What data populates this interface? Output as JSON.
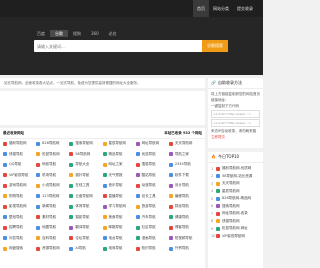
{
  "nav": {
    "items": [
      {
        "label": "首页",
        "active": true
      },
      {
        "label": "网站分类",
        "active": false
      },
      {
        "label": "提交收录",
        "active": false
      }
    ]
  },
  "search": {
    "tabs": [
      "百度",
      "谷歌",
      "搜狗",
      "360",
      "必应"
    ],
    "active_tab": "谷歌",
    "placeholder": "请输入关键词...",
    "button_label": "谷歌搜索"
  },
  "notice": "站长导航网，全面收录各大站点，一站式导航，免费为您提供高效便捷的网址大全服务。",
  "main": {
    "title": "最近收录网站",
    "right_text": "本站已收录 932 个网站",
    "sites": [
      {
        "name": "福利导航网",
        "color": "#e6473a"
      },
      {
        "name": "826导航网",
        "color": "#4a90e2"
      },
      {
        "name": "搜索导航网",
        "color": "#2aa876"
      },
      {
        "name": "星辰导航网",
        "color": "#f5a623"
      },
      {
        "name": "网址导航网",
        "color": "#9b59b6"
      },
      {
        "name": "天天导航网",
        "color": "#e6473a"
      },
      {
        "name": "快猫导航",
        "color": "#4a90e2"
      },
      {
        "name": "松鼠导航网",
        "color": "#f5a623"
      },
      {
        "name": "58导航网",
        "color": "#e6473a"
      },
      {
        "name": "精品导航",
        "color": "#2aa876"
      },
      {
        "name": "优选导航",
        "color": "#4a90e2"
      },
      {
        "name": "导航之家",
        "color": "#9b59b6"
      },
      {
        "name": "QQ导航",
        "color": "#4a90e2"
      },
      {
        "name": "蚂蚁导航",
        "color": "#e6473a"
      },
      {
        "name": "导航大全",
        "color": "#2aa876"
      },
      {
        "name": "网址之家",
        "color": "#f5a623"
      },
      {
        "name": "搜狐导航",
        "color": "#e6473a"
      },
      {
        "name": "2345导航",
        "color": "#4a90e2"
      },
      {
        "name": "VIP影视导航",
        "color": "#e6473a"
      },
      {
        "name": "机场导航",
        "color": "#4a90e2"
      },
      {
        "name": "猫扑导航",
        "color": "#f5a623"
      },
      {
        "name": "天气预报",
        "color": "#2aa876"
      },
      {
        "name": "酷站导航",
        "color": "#9b59b6"
      },
      {
        "name": "软件下载",
        "color": "#4a90e2"
      },
      {
        "name": "游戏导航网",
        "color": "#e6473a"
      },
      {
        "name": "小说导航网",
        "color": "#f5a623"
      },
      {
        "name": "在线工具",
        "color": "#2aa876"
      },
      {
        "name": "音乐导航",
        "color": "#4a90e2"
      },
      {
        "name": "动漫导航",
        "color": "#e6473a"
      },
      {
        "name": "设计导航",
        "color": "#9b59b6"
      },
      {
        "name": "购物导航",
        "color": "#f5a623"
      },
      {
        "name": "123导航网",
        "color": "#4a90e2"
      },
      {
        "name": "云盘导航网",
        "color": "#2aa876"
      },
      {
        "name": "直播导航",
        "color": "#e6473a"
      },
      {
        "name": "站长工具",
        "color": "#4a90e2"
      },
      {
        "name": "编程导航",
        "color": "#f5a623"
      },
      {
        "name": "影视导航网",
        "color": "#e6473a"
      },
      {
        "name": "新闻导航",
        "color": "#4a90e2"
      },
      {
        "name": "体育导航",
        "color": "#2aa876"
      },
      {
        "name": "学习导航网",
        "color": "#9b59b6"
      },
      {
        "name": "旅游导航",
        "color": "#f5a623"
      },
      {
        "name": "财经导航",
        "color": "#e6473a"
      },
      {
        "name": "壁纸导航",
        "color": "#4a90e2"
      },
      {
        "name": "素材导航",
        "color": "#e6473a"
      },
      {
        "name": "摄影导航",
        "color": "#2aa876"
      },
      {
        "name": "美食导航",
        "color": "#f5a623"
      },
      {
        "name": "汽车导航",
        "color": "#4a90e2"
      },
      {
        "name": "健康导航",
        "color": "#2aa876"
      },
      {
        "name": "招聘导航",
        "color": "#e6473a"
      },
      {
        "name": "地图导航",
        "color": "#4a90e2"
      },
      {
        "name": "翻译导航",
        "color": "#9b59b6"
      },
      {
        "name": "邮箱导航",
        "color": "#f5a623"
      },
      {
        "name": "社区导航",
        "color": "#2aa876"
      },
      {
        "name": "博客导航",
        "color": "#e6473a"
      },
      {
        "name": "问答导航",
        "color": "#4a90e2"
      },
      {
        "name": "百科导航",
        "color": "#f5a623"
      },
      {
        "name": "论坛导航",
        "color": "#e6473a"
      },
      {
        "name": "电台导航",
        "color": "#4a90e2"
      },
      {
        "name": "漫画导航",
        "color": "#2aa876"
      },
      {
        "name": "短视频导航",
        "color": "#9b59b6"
      },
      {
        "name": "网盘搜索",
        "color": "#f5a623"
      },
      {
        "name": "资源导航网",
        "color": "#e6473a"
      },
      {
        "name": "AI导航",
        "color": "#4a90e2"
      },
      {
        "name": "电商导航",
        "color": "#2aa876"
      },
      {
        "name": "知识导航",
        "color": "#e6473a"
      },
      {
        "name": "外贸导航",
        "color": "#4a90e2"
      }
    ]
  },
  "side1": {
    "title": "自助收录方法",
    "lines": [
      "将上方链接复制到您的网站首页",
      "链接地址：",
      "一键复制下方代码"
    ],
    "fields": [
      "<a href=\"http://www...\">",
      "<a href=\"http://www...\">"
    ],
    "note": "来访IP自动收录，请勿刷来路",
    "button": "立即提交"
  },
  "side2": {
    "title": "今日TOP10",
    "items": [
      {
        "name": "福利导航网-优质网",
        "color": "#e6473a"
      },
      {
        "name": "58导航网-站长资源",
        "color": "#4a90e2"
      },
      {
        "name": "天天导航网",
        "color": "#f5a623"
      },
      {
        "name": "星辰导航网",
        "color": "#2aa876"
      },
      {
        "name": "826导航网-精品网",
        "color": "#4a90e2"
      },
      {
        "name": "搜索导航网",
        "color": "#9b59b6"
      },
      {
        "name": "网址导航网-收录",
        "color": "#e6473a"
      },
      {
        "name": "快猫导航网",
        "color": "#f5a623"
      },
      {
        "name": "松鼠导航网-网址",
        "color": "#2aa876"
      },
      {
        "name": "VIP影视导航网",
        "color": "#e6473a"
      }
    ]
  }
}
